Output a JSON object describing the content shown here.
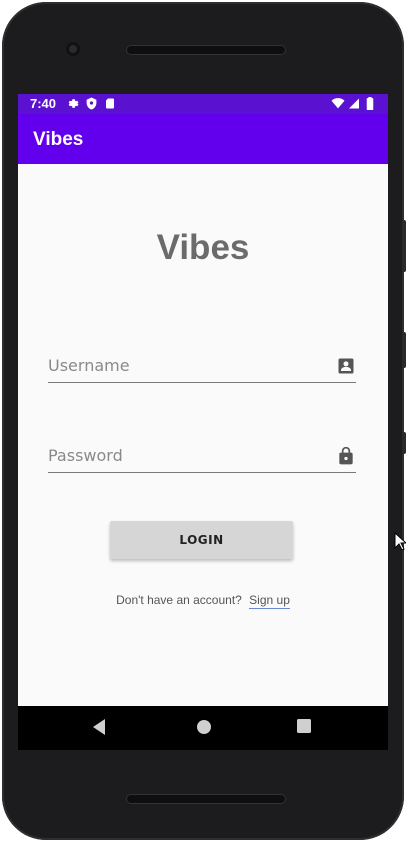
{
  "status_bar": {
    "time": "7:40",
    "icons": [
      "gear-icon",
      "shield-icon",
      "sim-card-icon",
      "wifi-icon",
      "signal-icon",
      "battery-icon"
    ]
  },
  "app_bar": {
    "title": "Vibes"
  },
  "login": {
    "logo_text": "Vibes",
    "username_placeholder": "Username",
    "password_placeholder": "Password",
    "login_label": "LOGIN",
    "no_account_text": "Don't have an account?",
    "signup_label": "Sign up"
  },
  "colors": {
    "status_bar": "#5a12d0",
    "app_bar": "#6200ee",
    "title_gray": "#6b6b6b",
    "button_gray": "#d6d6d6"
  },
  "nav_bar": {
    "buttons": [
      "back-icon",
      "home-icon",
      "recents-icon"
    ]
  }
}
